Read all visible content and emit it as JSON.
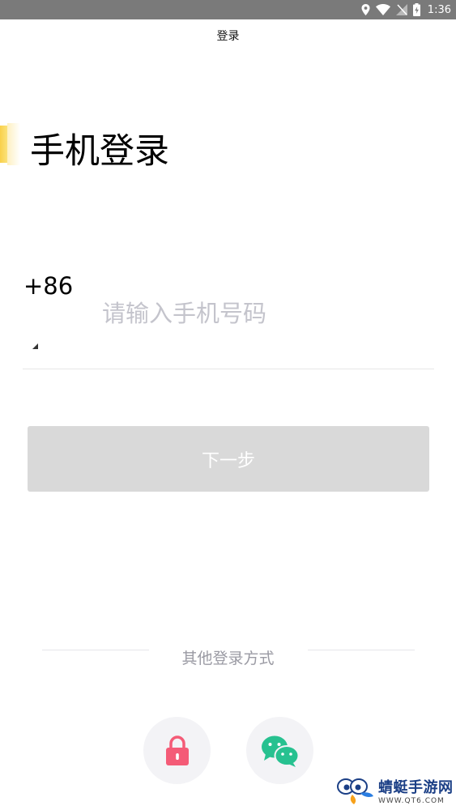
{
  "status_bar": {
    "time": "1:36",
    "icons": [
      "location-icon",
      "wifi-icon",
      "no-signal-icon",
      "battery-charging-icon"
    ]
  },
  "header": {
    "title": "登录"
  },
  "main": {
    "title": "手机登录",
    "country_code": "+86",
    "phone_input": {
      "value": "",
      "placeholder": "请输入手机号码"
    },
    "next_button_label": "下一步"
  },
  "other_login": {
    "label": "其他登录方式",
    "options": [
      {
        "icon": "lock-icon",
        "color": "#f45b77"
      },
      {
        "icon": "wechat-icon",
        "color": "#27c190"
      }
    ]
  },
  "watermark": {
    "name": "蜻蜓手游网",
    "url": "WWW.QT6.COM"
  },
  "colors": {
    "accent": "#f9d04a",
    "button_disabled": "#d9d9d9",
    "placeholder": "#c4c4cc",
    "muted_text": "#9a9aa3",
    "status_bar": "#7a7a7a"
  }
}
